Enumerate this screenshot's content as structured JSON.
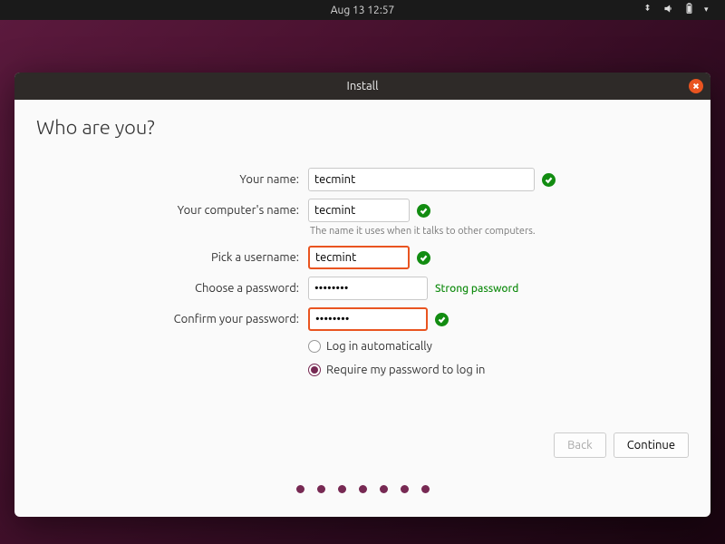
{
  "topbar": {
    "datetime": "Aug 13  12:57"
  },
  "window": {
    "title": "Install"
  },
  "page": {
    "heading": "Who are you?",
    "labels": {
      "name": "Your name:",
      "computer": "Your computer's name:",
      "computer_hint": "The name it uses when it talks to other computers.",
      "username": "Pick a username:",
      "password": "Choose a password:",
      "confirm": "Confirm your password:"
    },
    "values": {
      "name": "tecmint",
      "computer": "tecmint",
      "username": "tecmint",
      "password": "••••••••",
      "confirm": "••••••••",
      "pw_strength": "Strong password"
    },
    "radios": {
      "auto": "Log in automatically",
      "require": "Require my password to log in"
    },
    "footer": {
      "back": "Back",
      "continue": "Continue"
    }
  }
}
